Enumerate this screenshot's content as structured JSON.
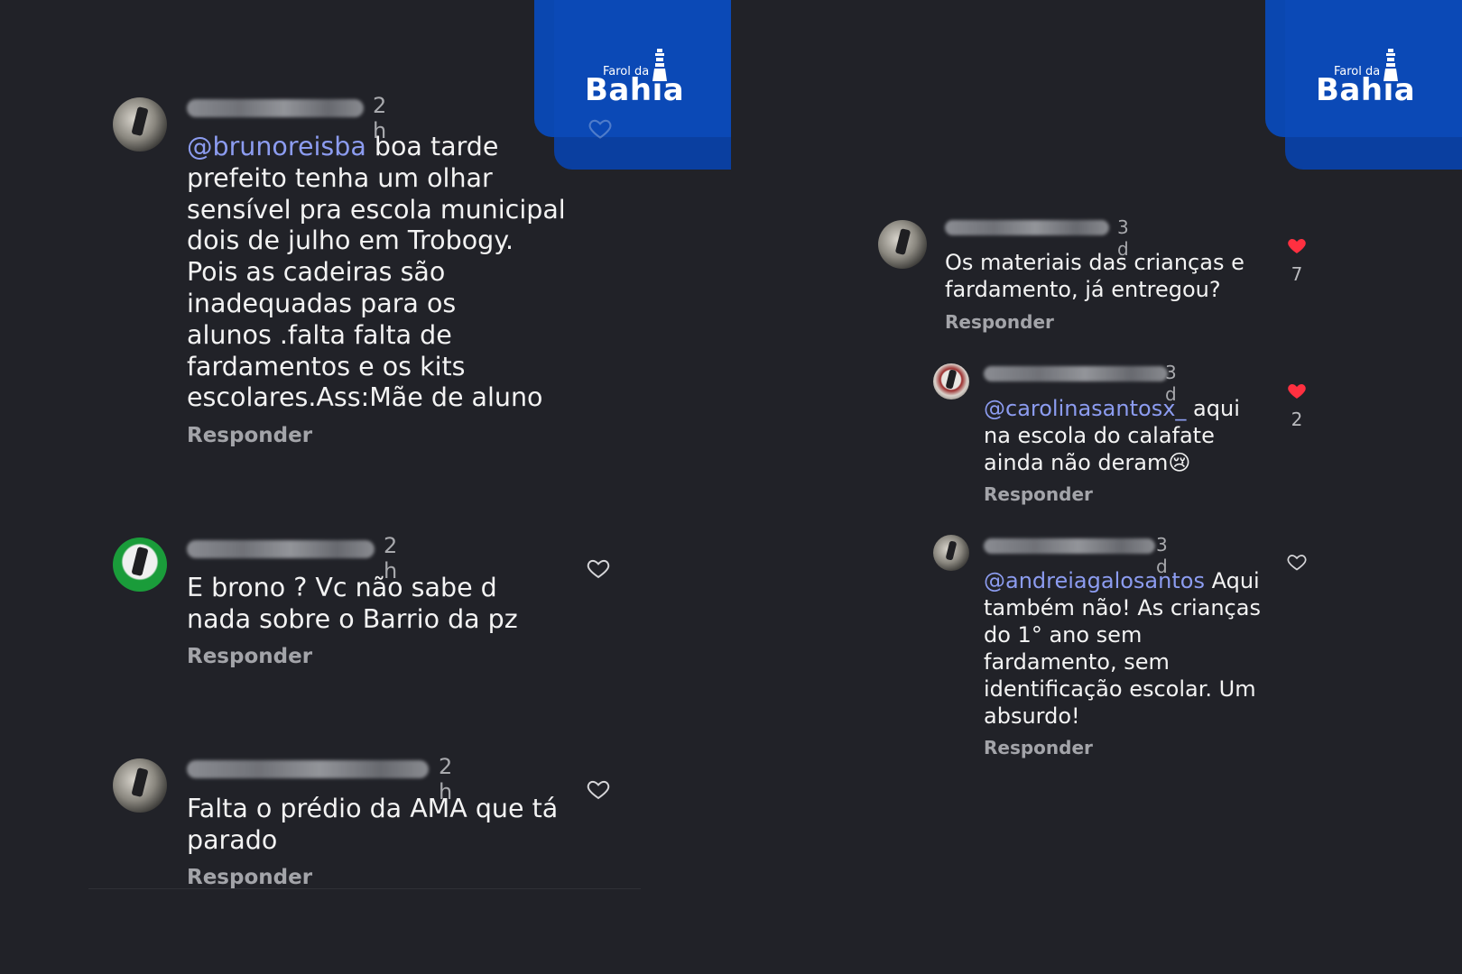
{
  "logo": {
    "small_text": "Farol da",
    "big_text": "Bahia"
  },
  "left": {
    "comments": [
      {
        "time": "2 h",
        "mention": "@brunoreisba",
        "text": " boa tarde\nprefeito tenha um olhar\nsensível pra escola municipal\ndois de julho em Trobogy.\nPois as cadeiras são\ninadequadas para os\nalunos .falta falta de\nfardamentos e os kits\nescolares.Ass:Mãe de aluno",
        "reply": "Responder"
      },
      {
        "time": "2 h",
        "text": "E brono ? Vc não sabe d\nnada sobre o Barrio da pz",
        "reply": "Responder"
      },
      {
        "time": "2 h",
        "text": "Falta o prédio da AMA que tá\nparado",
        "reply": "Responder"
      }
    ]
  },
  "right": {
    "comments": [
      {
        "time": "3 d",
        "text": "Os materiais das crianças e\nfardamento, já entregou?",
        "reply": "Responder",
        "likes": "7"
      },
      {
        "time": "3 d",
        "mention": "@carolinasantosx_",
        "text": " aqui\nna escola do calafate\nainda não deram😢",
        "reply": "Responder",
        "likes": "2"
      },
      {
        "time": "3 d",
        "mention": "@andreiagalosantos",
        "text": " Aqui\ntambém não! As crianças\ndo 1° ano sem\nfardamento, sem\nidentificação escolar. Um\nabsurdo!",
        "reply": "Responder"
      }
    ]
  },
  "colors": {
    "background": "#212228",
    "mention": "#8c9cf0",
    "liked_heart": "#ff3040",
    "logo_blue": "#0b49b6"
  }
}
